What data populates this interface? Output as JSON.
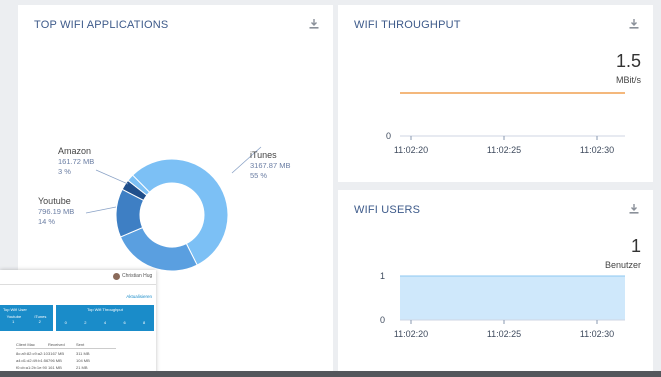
{
  "cards": {
    "apps": {
      "title": "TOP WIFI APPLICATIONS"
    },
    "throughput": {
      "title": "WIFI THROUGHPUT",
      "value": "1.5",
      "unit": "MBit/s"
    },
    "users": {
      "title": "WIFI USERS",
      "value": "1",
      "unit": "Benutzer"
    }
  },
  "icons": {
    "download": "download-icon",
    "user": "user-avatar-icon"
  },
  "colors": {
    "accent": "#3d5a8a",
    "line": "#f0a050",
    "area": "#cfe8fb",
    "area_line": "#8cc7f2",
    "mini_header": "#1a8cc9"
  },
  "donut": {
    "slices": [
      {
        "name": "iTunes",
        "size": "3167.87 MB",
        "pct": "55 %",
        "value": 55,
        "color": "#7cc0f5"
      },
      {
        "name": "",
        "size": "",
        "pct": "",
        "value": 26,
        "color": "#5a9fe0"
      },
      {
        "name": "Youtube",
        "size": "796.19 MB",
        "pct": "14 %",
        "value": 14,
        "color": "#3e7fc4"
      },
      {
        "name": "Amazon",
        "size": "161.72 MB",
        "pct": "3 %",
        "value": 3,
        "color": "#1f4f8c"
      },
      {
        "name": "",
        "size": "",
        "pct": "",
        "value": 2,
        "color": "#7cc0f5"
      }
    ]
  },
  "chart_data": [
    {
      "type": "line",
      "x": [
        "11:02:20",
        "11:02:25",
        "11:02:30"
      ],
      "y_ticks": [
        "0"
      ],
      "series": [
        {
          "values": [
            1.5,
            1.5,
            1.5
          ]
        }
      ]
    },
    {
      "type": "area",
      "x": [
        "11:02:20",
        "11:02:25",
        "11:02:30"
      ],
      "y_ticks": [
        "0",
        "1"
      ],
      "series": [
        {
          "values": [
            1,
            1,
            1
          ]
        }
      ]
    }
  ],
  "mini_window": {
    "user_name": "Christian Hug",
    "link": "Aktualisieren",
    "panel_left_title": "Top Wifi User",
    "panel_left_cols": [
      "Youtube",
      "iTunes"
    ],
    "panel_left_vals": [
      "1",
      "2"
    ],
    "panel_right_title": "Top Wifi Throughput",
    "panel_right_vals": [
      "0",
      "2",
      "4",
      "6",
      "8"
    ],
    "table_headers": [
      "Client Mac",
      "Received",
      "Sent"
    ],
    "table_rows": [
      [
        "8c:a9:82:c9:a2:10",
        "3167 MB",
        "311 MB"
      ],
      [
        "a4:d1:d2:49:b1:56",
        "796 MB",
        "104 MB"
      ],
      [
        "f0:cb:a1:2b:1e:90",
        "161 MB",
        "21 MB"
      ]
    ]
  }
}
